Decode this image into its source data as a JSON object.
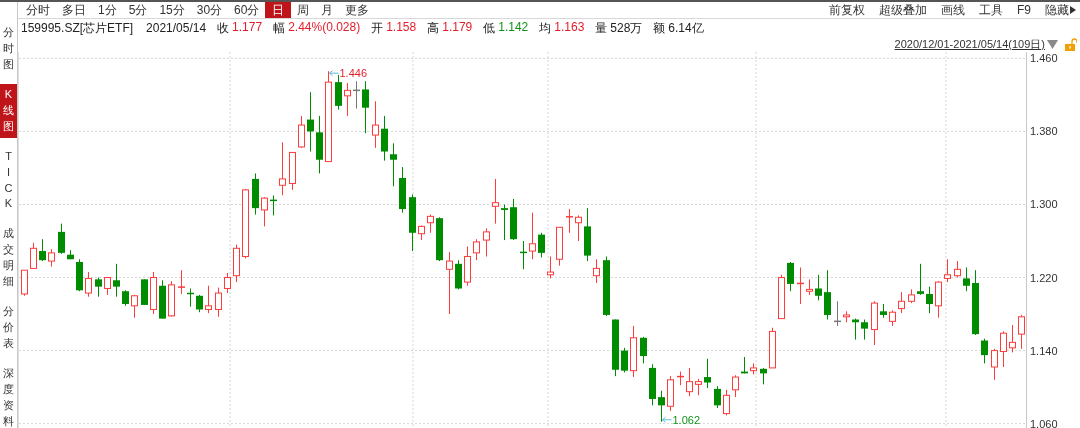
{
  "toolbar": {
    "periods": [
      {
        "label": "分时",
        "selected": false
      },
      {
        "label": "多日",
        "selected": false
      },
      {
        "label": "1分",
        "selected": false
      },
      {
        "label": "5分",
        "selected": false
      },
      {
        "label": "15分",
        "selected": false
      },
      {
        "label": "30分",
        "selected": false
      },
      {
        "label": "60分",
        "selected": false
      },
      {
        "label": "日",
        "selected": true
      },
      {
        "label": "周",
        "selected": false
      },
      {
        "label": "月",
        "selected": false
      },
      {
        "label": "更多",
        "selected": false
      }
    ],
    "actions": [
      {
        "label": "前复权",
        "kind": "plain"
      },
      {
        "label": "超级叠加",
        "kind": "plain"
      },
      {
        "label": "画线",
        "kind": "plain"
      },
      {
        "label": "工具",
        "kind": "plain"
      },
      {
        "label": "F9",
        "kind": "plain"
      },
      {
        "label": "隐藏",
        "kind": "menu"
      }
    ]
  },
  "side_tabs": [
    {
      "label": "分时图",
      "selected": false
    },
    {
      "label": "K线图",
      "selected": true
    },
    {
      "label": "TICK",
      "selected": false
    },
    {
      "label": "成交明细",
      "selected": false
    },
    {
      "label": "分价表",
      "selected": false
    },
    {
      "label": "深度资料",
      "selected": false
    }
  ],
  "quote": {
    "symbol": "159995.SZ[芯片ETF]",
    "date": "2021/05/14",
    "fields": [
      {
        "label": "收",
        "value": "1.177",
        "color": "#e41d2a"
      },
      {
        "label": "幅",
        "value": "2.44%(0.028)",
        "color": "#e41d2a"
      },
      {
        "label": "开",
        "value": "1.158",
        "color": "#e41d2a"
      },
      {
        "label": "高",
        "value": "1.179",
        "color": "#e41d2a"
      },
      {
        "label": "低",
        "value": "1.142",
        "color": "#13931d"
      },
      {
        "label": "均",
        "value": "1.163",
        "color": "#e41d2a"
      },
      {
        "label": "量",
        "value": "528万"
      },
      {
        "label": "额",
        "value": "6.14亿"
      }
    ]
  },
  "range": {
    "label": "2020/12/01-2021/05/14(109日)",
    "locked": false
  },
  "chart": {
    "chart_data": {
      "type": "candlestick",
      "grid": true,
      "ylim": [
        1.053,
        1.467
      ],
      "yticks": [
        {
          "value": 1.46,
          "label": "1.460"
        },
        {
          "value": 1.38,
          "label": "1.380"
        },
        {
          "value": 1.3,
          "label": "1.300"
        },
        {
          "value": 1.22,
          "label": "1.220"
        },
        {
          "value": 1.14,
          "label": "1.140"
        },
        {
          "value": 1.06,
          "label": "1.060"
        }
      ],
      "ohlc": [
        [
          1.202,
          1.228,
          1.2,
          1.228
        ],
        [
          1.23,
          1.258,
          1.23,
          1.252
        ],
        [
          1.249,
          1.262,
          1.238,
          1.239
        ],
        [
          1.238,
          1.251,
          1.232,
          1.247
        ],
        [
          1.27,
          1.279,
          1.246,
          1.247
        ],
        [
          1.245,
          1.25,
          1.24,
          1.24
        ],
        [
          1.237,
          1.24,
          1.205,
          1.206
        ],
        [
          1.203,
          1.226,
          1.199,
          1.219
        ],
        [
          1.218,
          1.22,
          1.199,
          1.21
        ],
        [
          1.208,
          1.22,
          1.201,
          1.22
        ],
        [
          1.217,
          1.235,
          1.199,
          1.21
        ],
        [
          1.205,
          1.206,
          1.189,
          1.191
        ],
        [
          1.189,
          1.201,
          1.176,
          1.2
        ],
        [
          1.218,
          1.218,
          1.19,
          1.19
        ],
        [
          1.185,
          1.226,
          1.18,
          1.22
        ],
        [
          1.211,
          1.217,
          1.175,
          1.175
        ],
        [
          1.178,
          1.216,
          1.177,
          1.212
        ],
        [
          1.209,
          1.228,
          1.202,
          1.21
        ],
        [
          1.203,
          1.208,
          1.188,
          1.202
        ],
        [
          1.2,
          1.201,
          1.182,
          1.185
        ],
        [
          1.185,
          1.211,
          1.181,
          1.189
        ],
        [
          1.185,
          1.209,
          1.177,
          1.203
        ],
        [
          1.208,
          1.225,
          1.203,
          1.22
        ],
        [
          1.222,
          1.256,
          1.215,
          1.252
        ],
        [
          1.243,
          1.317,
          1.241,
          1.316
        ],
        [
          1.328,
          1.334,
          1.289,
          1.296
        ],
        [
          1.294,
          1.308,
          1.276,
          1.307
        ],
        [
          1.305,
          1.31,
          1.288,
          1.304
        ],
        [
          1.321,
          1.368,
          1.31,
          1.328
        ],
        [
          1.323,
          1.357,
          1.316,
          1.357
        ],
        [
          1.363,
          1.397,
          1.362,
          1.387
        ],
        [
          1.393,
          1.423,
          1.358,
          1.38
        ],
        [
          1.379,
          1.397,
          1.334,
          1.349
        ],
        [
          1.347,
          1.446,
          1.347,
          1.434
        ],
        [
          1.434,
          1.442,
          1.404,
          1.408
        ],
        [
          1.419,
          1.433,
          1.397,
          1.425
        ],
        [
          1.425,
          1.435,
          1.405,
          1.425
        ],
        [
          1.426,
          1.435,
          1.378,
          1.406
        ],
        [
          1.376,
          1.413,
          1.362,
          1.387
        ],
        [
          1.383,
          1.397,
          1.348,
          1.358
        ],
        [
          1.355,
          1.367,
          1.32,
          1.349
        ],
        [
          1.329,
          1.341,
          1.291,
          1.295
        ],
        [
          1.308,
          1.311,
          1.249,
          1.269
        ],
        [
          1.268,
          1.277,
          1.261,
          1.276
        ],
        [
          1.28,
          1.289,
          1.269,
          1.287
        ],
        [
          1.285,
          1.286,
          1.238,
          1.239
        ],
        [
          1.229,
          1.248,
          1.18,
          1.238
        ],
        [
          1.235,
          1.239,
          1.207,
          1.208
        ],
        [
          1.215,
          1.254,
          1.211,
          1.243
        ],
        [
          1.247,
          1.262,
          1.239,
          1.259
        ],
        [
          1.261,
          1.274,
          1.243,
          1.27
        ],
        [
          1.298,
          1.328,
          1.279,
          1.302
        ],
        [
          1.296,
          1.3,
          1.261,
          1.294
        ],
        [
          1.297,
          1.306,
          1.261,
          1.262
        ],
        [
          1.248,
          1.26,
          1.229,
          1.247
        ],
        [
          1.249,
          1.291,
          1.24,
          1.257
        ],
        [
          1.267,
          1.269,
          1.242,
          1.247
        ],
        [
          1.223,
          1.243,
          1.219,
          1.226
        ],
        [
          1.24,
          1.275,
          1.233,
          1.275
        ],
        [
          1.286,
          1.295,
          1.269,
          1.287
        ],
        [
          1.28,
          1.288,
          1.26,
          1.286
        ],
        [
          1.276,
          1.296,
          1.238,
          1.244
        ],
        [
          1.222,
          1.24,
          1.214,
          1.23
        ],
        [
          1.239,
          1.243,
          1.178,
          1.179
        ],
        [
          1.174,
          1.174,
          1.112,
          1.119
        ],
        [
          1.14,
          1.143,
          1.116,
          1.118
        ],
        [
          1.118,
          1.167,
          1.111,
          1.154
        ],
        [
          1.154,
          1.155,
          1.126,
          1.134
        ],
        [
          1.121,
          1.125,
          1.08,
          1.087
        ],
        [
          1.089,
          1.096,
          1.062,
          1.08
        ],
        [
          1.079,
          1.112,
          1.074,
          1.108
        ],
        [
          1.111,
          1.117,
          1.102,
          1.112
        ],
        [
          1.095,
          1.121,
          1.09,
          1.106
        ],
        [
          1.103,
          1.109,
          1.091,
          1.106
        ],
        [
          1.111,
          1.131,
          1.099,
          1.105
        ],
        [
          1.098,
          1.101,
          1.077,
          1.08
        ],
        [
          1.071,
          1.097,
          1.069,
          1.091
        ],
        [
          1.097,
          1.113,
          1.089,
          1.111
        ],
        [
          1.117,
          1.133,
          1.115,
          1.115
        ],
        [
          1.118,
          1.126,
          1.114,
          1.121
        ],
        [
          1.12,
          1.121,
          1.103,
          1.115
        ],
        [
          1.121,
          1.165,
          1.121,
          1.161
        ],
        [
          1.175,
          1.223,
          1.175,
          1.22
        ],
        [
          1.236,
          1.237,
          1.205,
          1.213
        ],
        [
          1.213,
          1.231,
          1.191,
          1.214
        ],
        [
          1.205,
          1.218,
          1.201,
          1.207
        ],
        [
          1.208,
          1.223,
          1.195,
          1.2
        ],
        [
          1.204,
          1.228,
          1.174,
          1.179
        ],
        [
          1.172,
          1.194,
          1.167,
          1.172
        ],
        [
          1.177,
          1.183,
          1.171,
          1.179
        ],
        [
          1.174,
          1.175,
          1.152,
          1.171
        ],
        [
          1.171,
          1.174,
          1.152,
          1.164
        ],
        [
          1.163,
          1.194,
          1.146,
          1.192
        ],
        [
          1.183,
          1.191,
          1.176,
          1.179
        ],
        [
          1.172,
          1.184,
          1.167,
          1.182
        ],
        [
          1.186,
          1.204,
          1.181,
          1.194
        ],
        [
          1.194,
          1.207,
          1.192,
          1.201
        ],
        [
          1.205,
          1.235,
          1.201,
          1.202
        ],
        [
          1.202,
          1.21,
          1.181,
          1.191
        ],
        [
          1.189,
          1.216,
          1.176,
          1.215
        ],
        [
          1.219,
          1.24,
          1.215,
          1.223
        ],
        [
          1.222,
          1.238,
          1.22,
          1.229
        ],
        [
          1.219,
          1.231,
          1.205,
          1.211
        ],
        [
          1.214,
          1.228,
          1.157,
          1.158
        ],
        [
          1.151,
          1.153,
          1.126,
          1.135
        ],
        [
          1.122,
          1.142,
          1.108,
          1.14
        ],
        [
          1.139,
          1.161,
          1.122,
          1.159
        ],
        [
          1.143,
          1.168,
          1.138,
          1.149
        ],
        [
          1.158,
          1.179,
          1.142,
          1.177
        ]
      ],
      "annotations": [
        "1.446",
        "1.062"
      ]
    }
  }
}
